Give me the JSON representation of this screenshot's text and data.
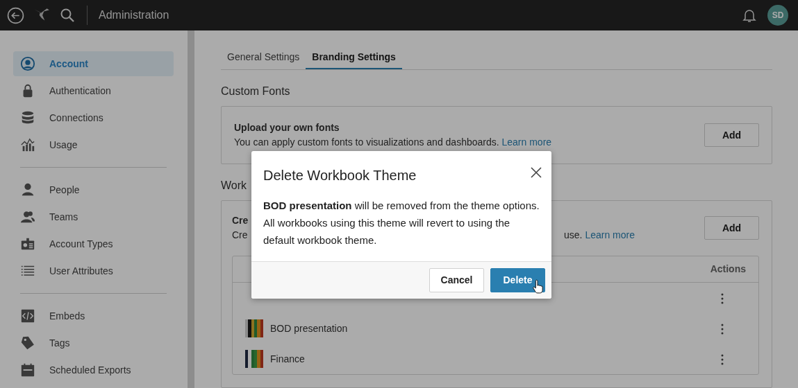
{
  "top_bar": {
    "title": "Administration",
    "avatar": "SD"
  },
  "sidebar": {
    "groups": [
      {
        "items": [
          {
            "label": "Account",
            "selected": true
          },
          {
            "label": "Authentication",
            "selected": false
          },
          {
            "label": "Connections",
            "selected": false
          },
          {
            "label": "Usage",
            "selected": false
          }
        ]
      },
      {
        "items": [
          {
            "label": "People",
            "selected": false
          },
          {
            "label": "Teams",
            "selected": false
          },
          {
            "label": "Account Types",
            "selected": false
          },
          {
            "label": "User Attributes",
            "selected": false
          }
        ]
      },
      {
        "items": [
          {
            "label": "Embeds",
            "selected": false
          },
          {
            "label": "Tags",
            "selected": false
          },
          {
            "label": "Scheduled Exports",
            "selected": false
          }
        ]
      }
    ]
  },
  "tabs": [
    {
      "label": "General Settings",
      "selected": false
    },
    {
      "label": "Branding Settings",
      "selected": true
    }
  ],
  "sections": [
    {
      "kind": "full",
      "title": "Custom Fonts",
      "card": {
        "heading": "Upload your own fonts",
        "description": "You can apply custom fonts to visualizations and dashboards.",
        "link": "Learn more",
        "button": "Add"
      }
    },
    {
      "kind": "covered",
      "title": "Work",
      "card": {
        "heading": "Cre",
        "description": "Cre",
        "description_end": "use.",
        "link": "Learn more",
        "button": "Add",
        "table": {
          "columns": [
            "Actions"
          ],
          "rows": [
            {
              "kind": "covered"
            },
            {
              "kind": "theme",
              "name": "BOD presentation",
              "swatch": [
                {
                  "color": "#8b8b8b"
                },
                {
                  "color": "#111111"
                },
                {
                  "color": "#8e7220"
                },
                {
                  "color": "#1f5c2b"
                },
                {
                  "color": "#966214"
                },
                {
                  "color": "#802615"
                }
              ]
            },
            {
              "kind": "theme",
              "name": "Finance",
              "swatch": [
                {
                  "color": "#151c2d"
                },
                {
                  "color": "#ababab"
                },
                {
                  "color": "#1f5c2b"
                },
                {
                  "color": "#29672d"
                },
                {
                  "color": "#966214"
                },
                {
                  "color": "#802615"
                }
              ]
            }
          ]
        }
      }
    }
  ],
  "modal": {
    "title": "Delete Workbook Theme",
    "body": "**BOD presentation** will be removed from the theme options. All workbooks using this theme will revert to using the default workbook theme.",
    "buttons": [
      {
        "label": "Cancel",
        "kind": "secondary"
      },
      {
        "label": "Delete",
        "kind": "primary"
      }
    ]
  }
}
